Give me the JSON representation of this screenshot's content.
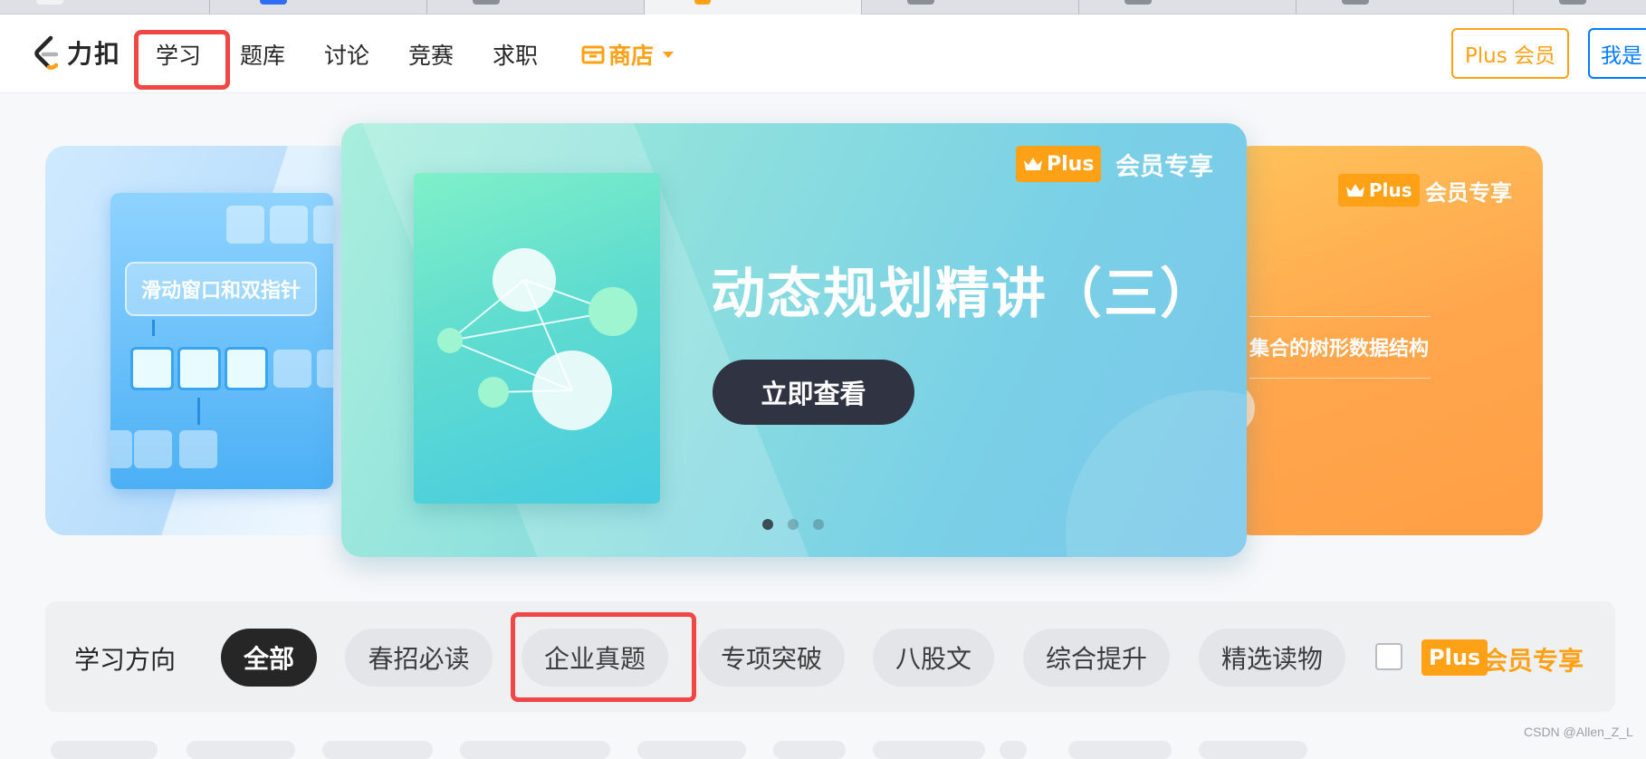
{
  "nav": {
    "logo_text": "力扣",
    "items": [
      {
        "label": "学习"
      },
      {
        "label": "题库"
      },
      {
        "label": "讨论"
      },
      {
        "label": "竞赛"
      },
      {
        "label": "求职"
      }
    ],
    "store_label": "商店",
    "plus_button": "Plus 会员",
    "iam_button": "我是"
  },
  "carousel": {
    "left_card": {
      "label": "滑动窗口和双指针"
    },
    "main_card": {
      "badge": "Plus",
      "badge_text": "会员专享",
      "title": "动态规划精讲（三）",
      "cta": "立即查看"
    },
    "right_card": {
      "badge": "Plus",
      "badge_text": "会员专享",
      "description": "集合的树形数据结构"
    },
    "page_count": 3,
    "active_page": 1
  },
  "filter": {
    "label": "学习方向",
    "chips": [
      {
        "label": "全部",
        "active": true
      },
      {
        "label": "春招必读"
      },
      {
        "label": "企业真题"
      },
      {
        "label": "专项突破"
      },
      {
        "label": "八股文"
      },
      {
        "label": "综合提升"
      },
      {
        "label": "精选读物"
      }
    ],
    "plus_badge": "Plus",
    "plus_text": "会员专享"
  },
  "watermark": "CSDN @Allen_Z_L",
  "colors": {
    "accent_orange": "#ffa116",
    "accent_blue": "#007aff",
    "highlight_red": "#f04646",
    "cta_dark": "#2f3342"
  }
}
